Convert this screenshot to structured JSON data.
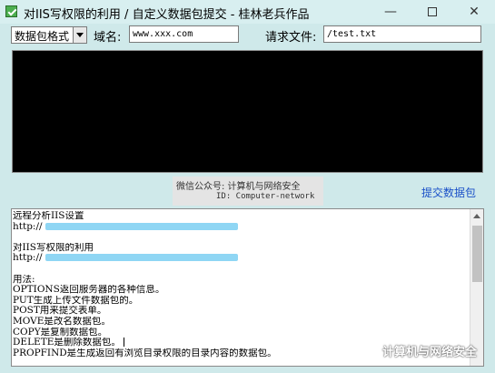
{
  "window": {
    "title": "对IIS写权限的利用 / 自定义数据包提交 - 桂林老兵作品",
    "minimize_glyph": "—",
    "close_glyph": "✕"
  },
  "form": {
    "format_select": "数据包格式",
    "domain_label": "域名:",
    "domain_value": "www.xxx.com",
    "file_label": "请求文件:",
    "file_value": "/test.txt"
  },
  "watermark_top": {
    "line1": "微信公众号: 计算机与网络安全",
    "line2": "ID: Computer-network"
  },
  "submit_label": "提交数据包",
  "log": {
    "lines": [
      "远程分析IIS设置",
      "http://",
      "",
      "对IIS写权限的利用",
      "http://",
      "",
      "用法:",
      "OPTIONS返回服务器的各种信息。",
      "PUT生成上传文件数据包的。",
      "POST用来提交表单。",
      "MOVE是改名数据包。",
      "COPY是复制数据包。",
      "DELETE是删除数据包。",
      "PROPFIND是生成返回有浏览目录权限的目录内容的数据包。"
    ]
  },
  "watermark_bottom": "计算机与网络安全",
  "icons": {
    "app": "app-icon",
    "dropdown": "chevron-down-icon",
    "scroll_up": "scroll-up-icon",
    "wechat": "wechat-icon"
  },
  "colors": {
    "window_bg": "#cfe9ea",
    "link": "#1a50c8",
    "blurred_url": "#8fd6f4"
  }
}
